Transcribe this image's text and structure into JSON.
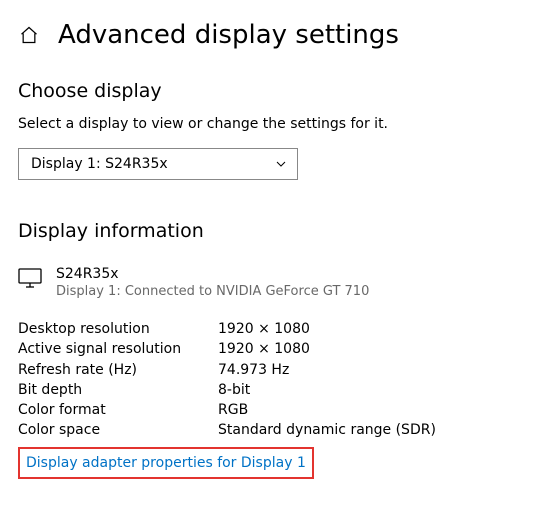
{
  "page": {
    "title": "Advanced display settings"
  },
  "choose": {
    "heading": "Choose display",
    "instruction": "Select a display to view or change the settings for it.",
    "selected": "Display 1: S24R35x"
  },
  "info": {
    "heading": "Display information",
    "monitor_name": "S24R35x",
    "monitor_sub": "Display 1: Connected to NVIDIA GeForce GT 710",
    "rows": [
      {
        "label": "Desktop resolution",
        "value": "1920 × 1080"
      },
      {
        "label": "Active signal resolution",
        "value": "1920 × 1080"
      },
      {
        "label": "Refresh rate (Hz)",
        "value": "74.973 Hz"
      },
      {
        "label": "Bit depth",
        "value": "8-bit"
      },
      {
        "label": "Color format",
        "value": "RGB"
      },
      {
        "label": "Color space",
        "value": "Standard dynamic range (SDR)"
      }
    ],
    "link": "Display adapter properties for Display 1"
  }
}
